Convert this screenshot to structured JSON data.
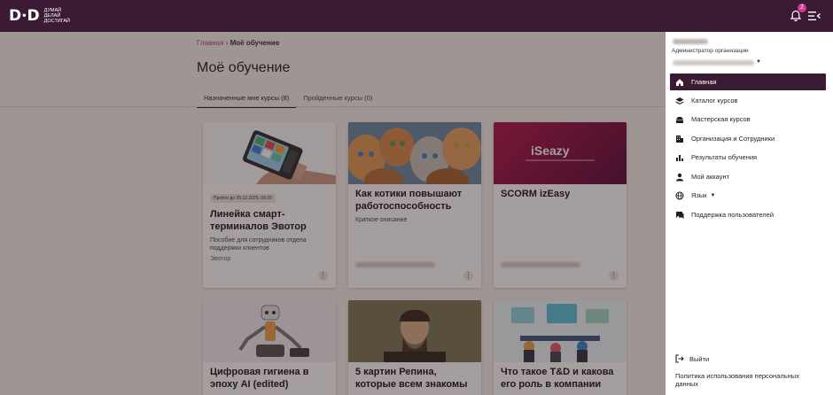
{
  "brand": {
    "logo_mark_left": "D",
    "logo_mark_mid": "•",
    "logo_mark_right": "D",
    "tagline": [
      "ДУМАЙ",
      "ДЕЛАЙ",
      "ДОСТИГАЙ"
    ]
  },
  "header": {
    "notifications_count": "2"
  },
  "breadcrumb": {
    "home": "Главная",
    "separator": "›",
    "current": "Моё обучение"
  },
  "page": {
    "title": "Моё обучение"
  },
  "tabs": [
    {
      "label": "Назначенные мне курсы (8)",
      "active": true
    },
    {
      "label": "Пройденные курсы (0)",
      "active": false
    }
  ],
  "cards": [
    {
      "chip": "Пройти до 25.12.2025, 09:20",
      "title": "Линейка смарт-терминалов Эвотор",
      "desc": "Пособие для сотрудников отдела поддержки клиентов",
      "author": "Эвотор"
    },
    {
      "title": "Как котики повышают работоспособность",
      "desc": "Краткое описание"
    },
    {
      "title": "SCORM izEasy",
      "banner_text": "iSeazy"
    },
    {
      "title": "Цифровая гигиена в эпоху AI (edited)"
    },
    {
      "title": "5 картин Репина, которые всем знакомы"
    },
    {
      "title": "Что такое T&D и какова его роль в компании"
    }
  ],
  "panel": {
    "role": "Администратор организации",
    "nav": [
      {
        "label": "Главная",
        "icon": "home-icon",
        "active": true
      },
      {
        "label": "Каталог курсов",
        "icon": "layers-icon"
      },
      {
        "label": "Мастерская курсов",
        "icon": "toolbox-icon"
      },
      {
        "label": "Организация и Сотрудники",
        "icon": "building-icon"
      },
      {
        "label": "Результаты обучения",
        "icon": "bar-chart-icon"
      },
      {
        "label": "Мой аккаунт",
        "icon": "person-icon"
      },
      {
        "label": "Язык",
        "icon": "globe-icon"
      },
      {
        "label": "Поддержка пользователей",
        "icon": "chat-icon"
      }
    ],
    "logout": "Выйти",
    "privacy": "Политика использования персональных данных"
  },
  "colors": {
    "brand_dark": "#3b1a33",
    "badge": "#d13a8f",
    "link": "#b84a6b"
  }
}
